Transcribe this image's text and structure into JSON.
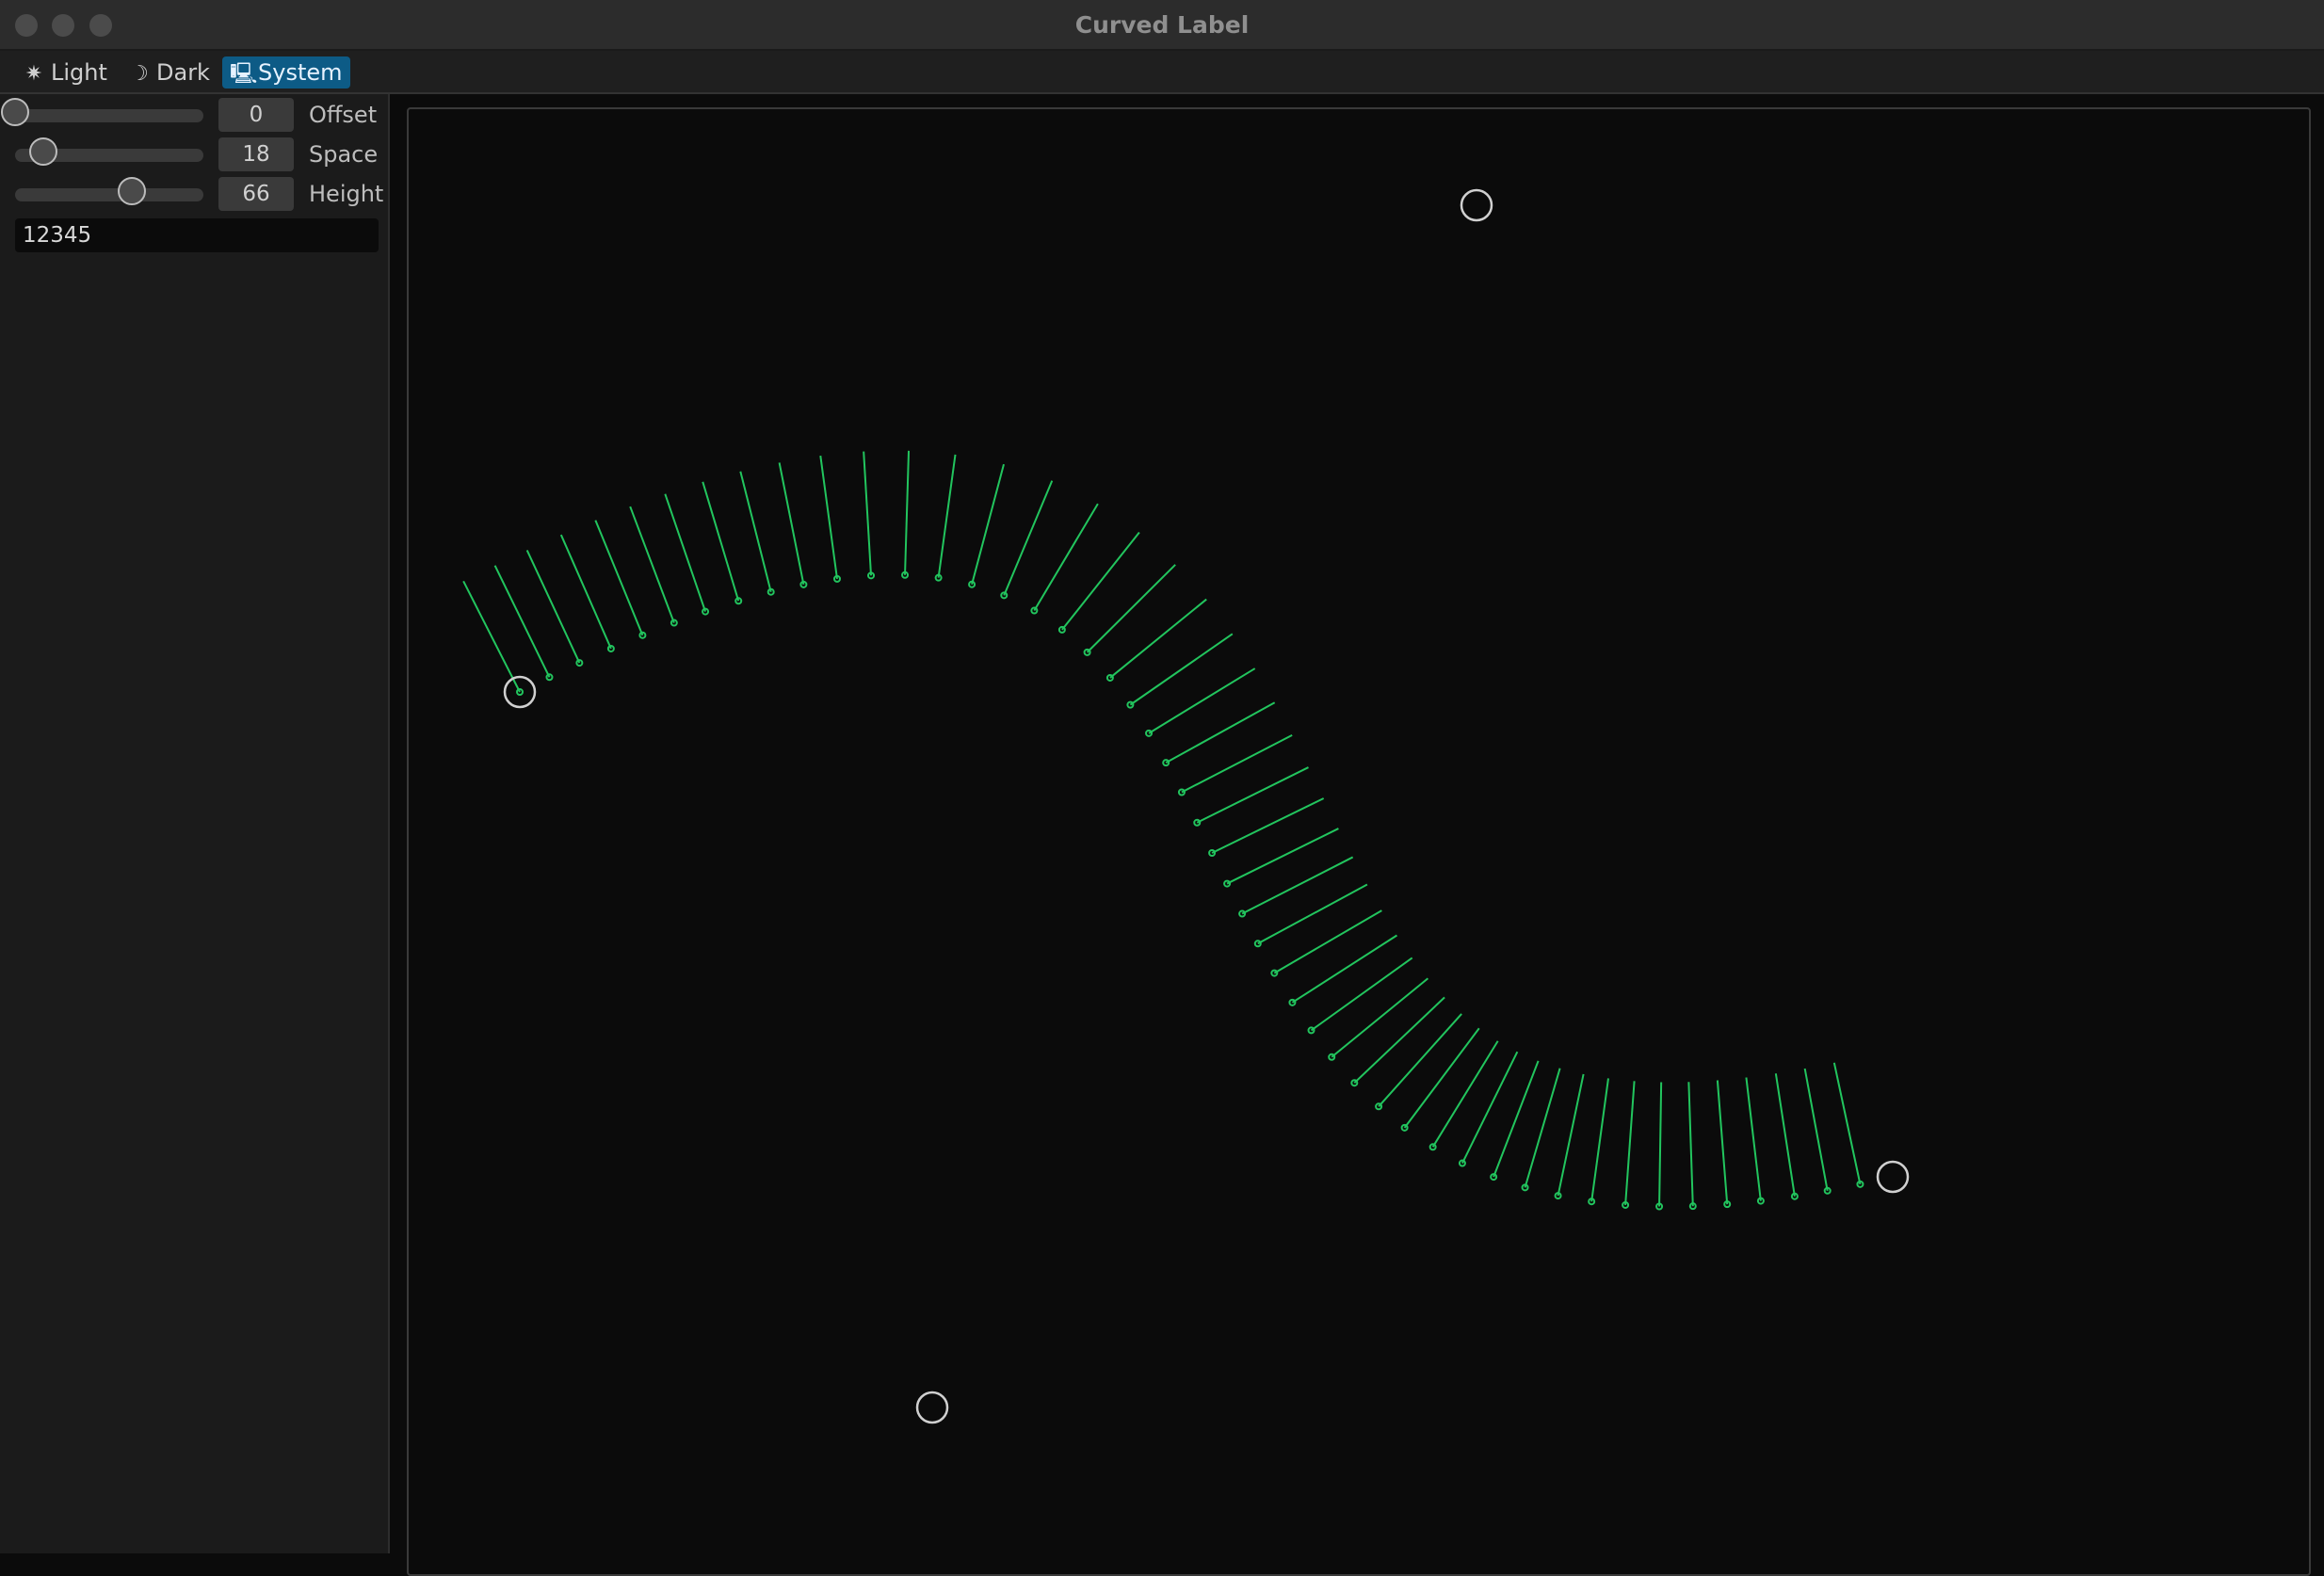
{
  "window": {
    "title": "Curved Label"
  },
  "theme_buttons": [
    {
      "label": "Light",
      "icon": "sun-icon"
    },
    {
      "label": "Dark",
      "icon": "moon-icon"
    },
    {
      "label": "System",
      "icon": "monitor-icon",
      "selected": true
    }
  ],
  "controls": {
    "offset": {
      "label": "Offset",
      "value": "0",
      "fraction": 0.0
    },
    "space": {
      "label": "Space",
      "value": "18",
      "fraction": 0.15
    },
    "height": {
      "label": "Height",
      "value": "66",
      "fraction": 0.62
    }
  },
  "text_field": {
    "value": "12345"
  },
  "colors": {
    "accent": "#0d5b86",
    "curve_ticks": "#22c55e",
    "handles": "#d0d0d0",
    "canvas_bg": "#0b0b0b"
  }
}
